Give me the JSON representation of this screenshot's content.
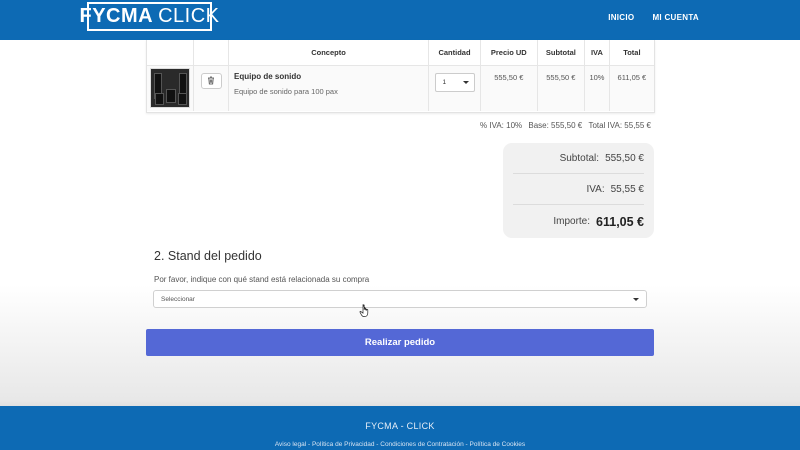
{
  "header": {
    "logo_bold": "FYCMA",
    "logo_light": "CLICK",
    "nav": [
      {
        "label": "INICIO"
      },
      {
        "label": "MI CUENTA"
      }
    ]
  },
  "cart": {
    "columns": [
      "Concepto",
      "Cantidad",
      "Precio UD",
      "Subtotal",
      "IVA",
      "Total"
    ],
    "items": [
      {
        "name": "Equipo de sonido",
        "description": "Equipo de sonido para 100 pax",
        "quantity": "1",
        "unit_price": "555,50 €",
        "subtotal": "555,50 €",
        "iva": "10%",
        "total": "611,05 €"
      }
    ]
  },
  "iva_breakdown": {
    "rate": "% IVA: 10%",
    "base": "Base: 555,50 €",
    "total": "Total IVA: 55,55 €"
  },
  "summary": {
    "subtotal_label": "Subtotal:",
    "subtotal_value": "555,50 €",
    "iva_label": "IVA:",
    "iva_value": "55,55 €",
    "total_label": "Importe:",
    "total_value": "611,05 €"
  },
  "stand": {
    "title": "2. Stand del pedido",
    "description": "Por favor, indique con qué stand está relacionada su compra",
    "select_value": "Seleccionar"
  },
  "submit_label": "Realizar pedido",
  "footer": {
    "brand": "FYCMA - CLICK",
    "links": [
      "Aviso legal",
      "Política de Privacidad",
      "Condiciones de Contratación",
      "Política de Cookies"
    ],
    "separator": " - "
  },
  "colors": {
    "primary": "#0d6ab4",
    "button": "#5468d6"
  }
}
